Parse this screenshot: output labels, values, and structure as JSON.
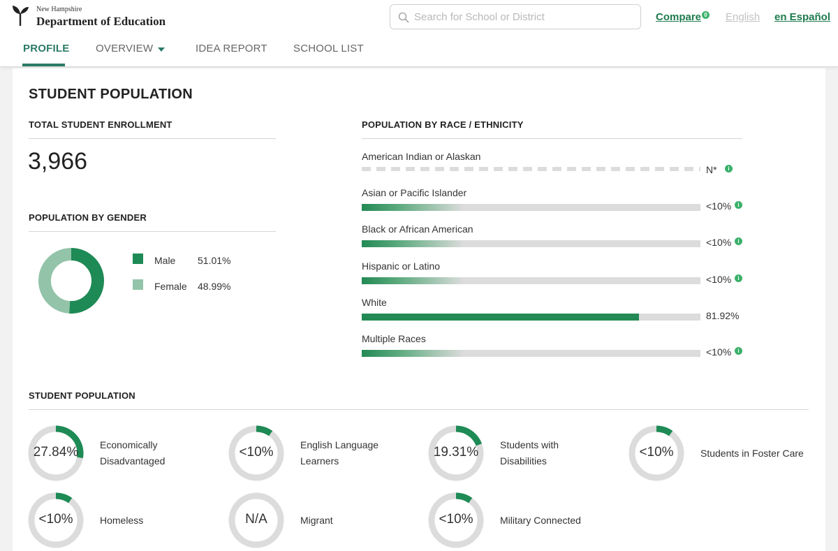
{
  "header": {
    "logo_small": "New Hampshire",
    "logo_big": "Department of Education",
    "search_placeholder": "Search for School or District",
    "compare_label": "Compare",
    "compare_count": "0",
    "english_label": "English",
    "espanol_label": "en Español"
  },
  "nav": {
    "tabs": [
      {
        "label": "PROFILE",
        "active": true
      },
      {
        "label": "OVERVIEW",
        "active": false
      },
      {
        "label": "IDEA REPORT",
        "active": false
      },
      {
        "label": "SCHOOL LIST",
        "active": false
      }
    ]
  },
  "main": {
    "title": "STUDENT POPULATION",
    "enrollment": {
      "heading": "TOTAL STUDENT ENROLLMENT",
      "value": "3,966"
    },
    "gender": {
      "heading": "POPULATION BY GENDER",
      "items": [
        {
          "label": "Male",
          "value": "51.01%",
          "fraction": 0.5101,
          "color": "#1e8a55"
        },
        {
          "label": "Female",
          "value": "48.99%",
          "fraction": 0.4899,
          "color": "#93c4a9"
        }
      ]
    },
    "race": {
      "heading": "POPULATION BY RACE / ETHNICITY",
      "items": [
        {
          "label": "American Indian or Alaskan",
          "value": "N*",
          "fraction": null,
          "info": true
        },
        {
          "label": "Asian or Pacific Islander",
          "value": "<10%",
          "fraction": 0.1,
          "info": true
        },
        {
          "label": "Black or African American",
          "value": "<10%",
          "fraction": 0.1,
          "info": true
        },
        {
          "label": "Hispanic or Latino",
          "value": "<10%",
          "fraction": 0.1,
          "info": true
        },
        {
          "label": "White",
          "value": "81.92%",
          "fraction": 0.8192,
          "info": false
        },
        {
          "label": "Multiple Races",
          "value": "<10%",
          "fraction": 0.1,
          "info": true
        }
      ]
    },
    "population": {
      "heading": "STUDENT POPULATION",
      "stats": [
        {
          "value": "27.84%",
          "fraction": 0.2784,
          "label_lines": [
            "Economically",
            "Disadvantaged"
          ]
        },
        {
          "value": "<10%",
          "fraction": 0.1,
          "label_lines": [
            "English Language",
            "Learners"
          ]
        },
        {
          "value": "19.31%",
          "fraction": 0.1931,
          "label_lines": [
            "Students with",
            "Disabilities"
          ]
        },
        {
          "value": "<10%",
          "fraction": 0.1,
          "label_lines": [
            "Students in Foster Care"
          ]
        },
        {
          "value": "<10%",
          "fraction": 0.1,
          "label_lines": [
            "Homeless"
          ]
        },
        {
          "value": "N/A",
          "fraction": 0,
          "label_lines": [
            "Migrant"
          ]
        },
        {
          "value": "<10%",
          "fraction": 0.1,
          "label_lines": [
            "Military Connected"
          ]
        }
      ]
    },
    "colors": {
      "accent": "#1e8a55",
      "ring_track": "#dcdcdc",
      "bar_track": "#dcdcdc",
      "info_green": "#3ab06a"
    }
  }
}
